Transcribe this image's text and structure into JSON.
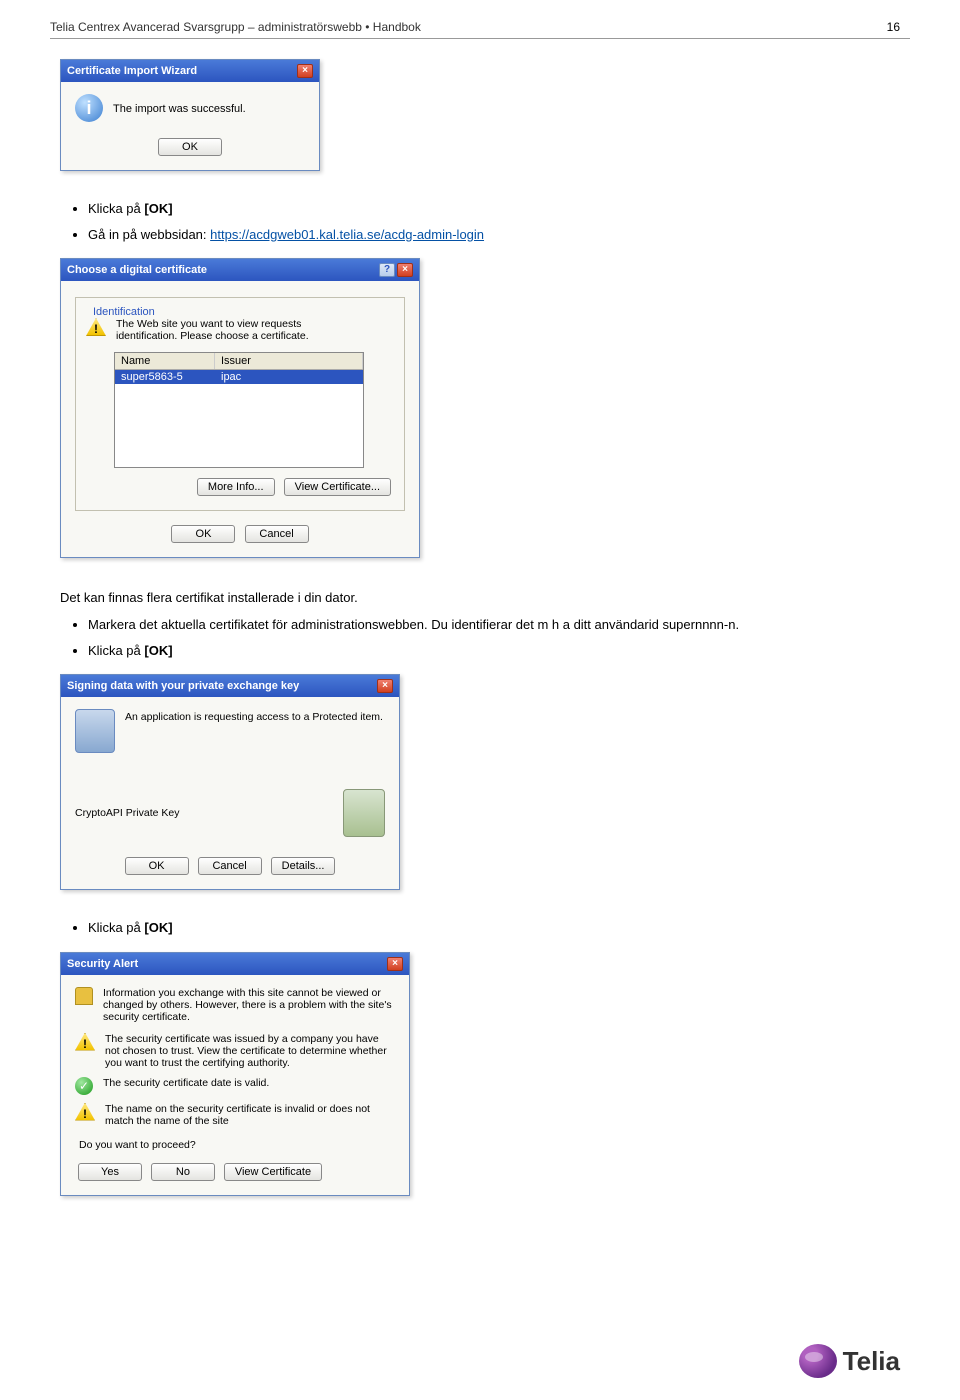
{
  "header": "Telia Centrex Avancerad Svarsgrupp – administratörswebb • Handbok",
  "page_number": "16",
  "bullets1": {
    "b1_prefix": "Klicka på ",
    "b1_bold": "[OK]",
    "b2_prefix": "Gå in på webbsidan: ",
    "b2_link": "https://acdgweb01.kal.telia.se/acdg-admin-login"
  },
  "para_mid": "Det kan finnas flera certifikat installerade i din dator.",
  "bullets2": {
    "b1": "Markera det aktuella certifikatet för administrationswebben. Du identifierar det m h a ditt användarid supernnnn-n.",
    "b2_prefix": "Klicka på ",
    "b2_bold": "[OK]"
  },
  "bullets3": {
    "b1_prefix": "Klicka på ",
    "b1_bold": "[OK]"
  },
  "dlg1": {
    "title": "Certificate Import Wizard",
    "msg": "The import was successful.",
    "ok": "OK"
  },
  "dlg2": {
    "title": "Choose a digital certificate",
    "section": "Identification",
    "msg1": "The Web site you want to view requests",
    "msg2": "identification. Please choose a certificate.",
    "col_name": "Name",
    "col_issuer": "Issuer",
    "row_name": "super5863-5",
    "row_issuer": "ipac",
    "more": "More Info...",
    "view": "View Certificate...",
    "ok": "OK",
    "cancel": "Cancel"
  },
  "dlg3": {
    "title": "Signing data with your private exchange key",
    "msg": "An application is requesting access to a Protected item.",
    "key_label": "CryptoAPI Private Key",
    "ok": "OK",
    "cancel": "Cancel",
    "details": "Details..."
  },
  "dlg4": {
    "title": "Security Alert",
    "intro": "Information you exchange with this site cannot be viewed or changed by others. However, there is a problem with the site's security certificate.",
    "w1": "The security certificate was issued by a company you have not chosen to trust. View the certificate to determine whether you want to trust the certifying authority.",
    "ok1": "The security certificate date is valid.",
    "w2": "The name on the security certificate is invalid or does not match the name of the site",
    "q": "Do you want to proceed?",
    "yes": "Yes",
    "no": "No",
    "view": "View Certificate"
  },
  "logo_text": "Telia"
}
